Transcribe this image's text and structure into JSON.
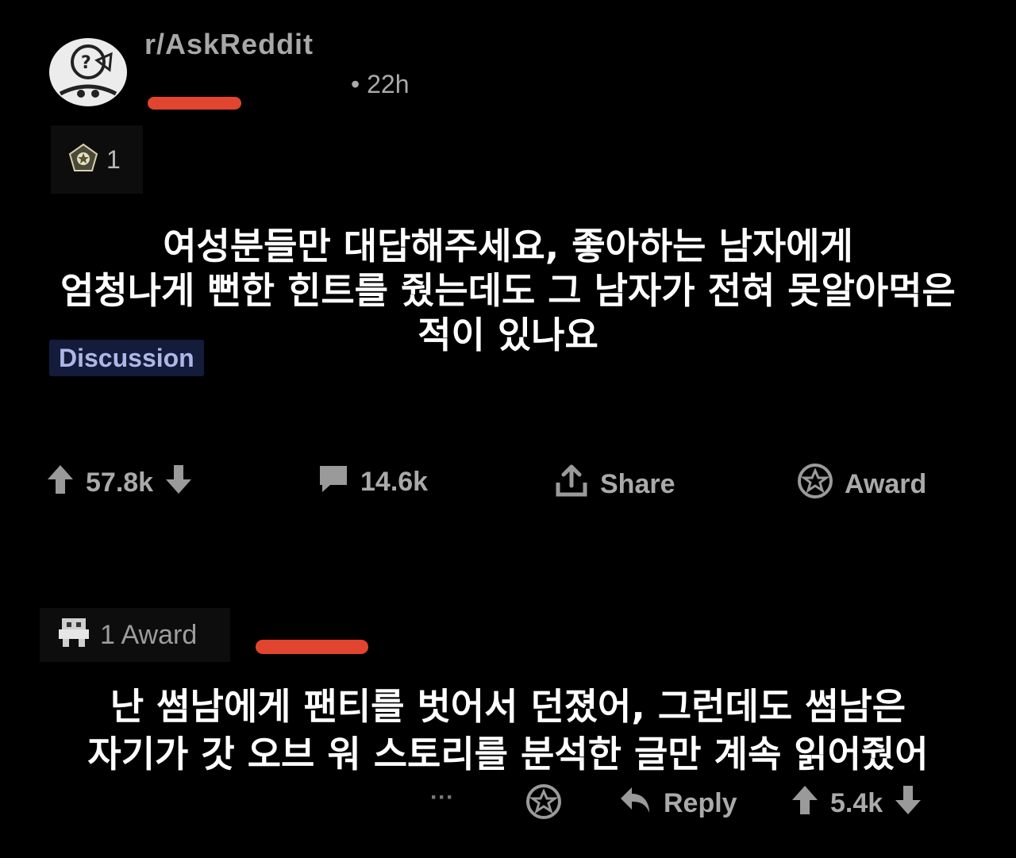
{
  "post": {
    "subreddit": "r/AskReddit",
    "time": "• 22h",
    "award_count": "1",
    "flair": "Discussion",
    "upvotes": "57.8k",
    "comments": "14.6k",
    "share_label": "Share",
    "award_label": "Award"
  },
  "captions": {
    "post_title": "여성분들만 대답해주세요, 좋아하는 남자에게\n엄청나게 뻔한 힌트를 줬는데도 그 남자가 전혀 못알아먹은\n적이 있나요",
    "comment_text": "난 썸남에게 팬티를 벗어서 던졌어, 그런데도 썸남은\n자기가 갓 오브 워 스토리를 분석한 글만 계속 읽어줬어"
  },
  "comment": {
    "award_label": "1 Award",
    "more": "···",
    "reply_label": "Reply",
    "votes": "5.4k"
  },
  "colors": {
    "background": "#000000",
    "redaction_mark": "#e2452f",
    "flair_bg": "#141c3c",
    "flair_text": "#aeb7e6",
    "caption_text": "#ffffff"
  }
}
